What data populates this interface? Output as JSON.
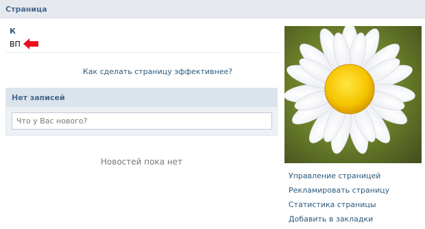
{
  "header": {
    "title": "Страница"
  },
  "page": {
    "name": "К",
    "status": "ВП"
  },
  "effective_link": "Как сделать страницу эффективнее?",
  "wall": {
    "header": "Нет записей",
    "input_placeholder": "Что у Вас нового?"
  },
  "news_empty": "Новостей пока нет",
  "sidebar_menu": [
    "Управление страницей",
    "Рекламировать страницу",
    "Статистика страницы",
    "Добавить в закладки"
  ],
  "colors": {
    "link": "#2b587a",
    "header_bar": "#e5e9ee",
    "annotation_arrow": "#e8101f"
  }
}
